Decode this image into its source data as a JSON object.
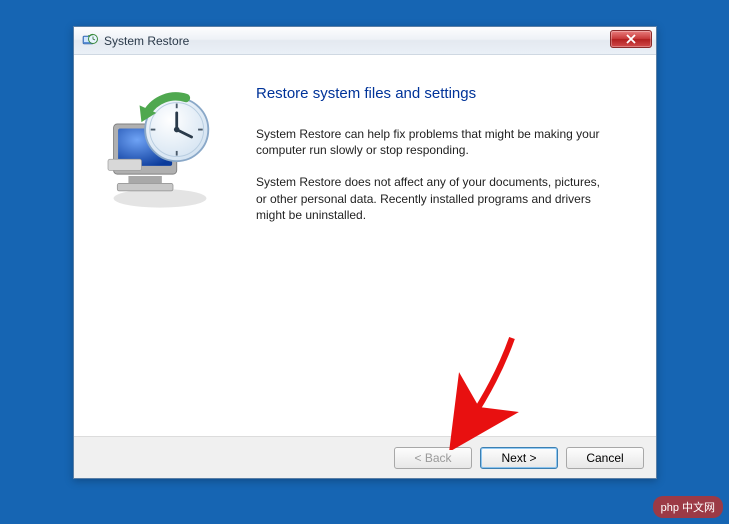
{
  "window": {
    "title": "System Restore"
  },
  "main": {
    "heading": "Restore system files and settings",
    "para1": "System Restore can help fix problems that might be making your computer run slowly or stop responding.",
    "para2": "System Restore does not affect any of your documents, pictures, or other personal data. Recently installed programs and drivers might be uninstalled."
  },
  "buttons": {
    "back": "< Back",
    "next": "Next >",
    "cancel": "Cancel"
  },
  "watermark": "php 中文网"
}
